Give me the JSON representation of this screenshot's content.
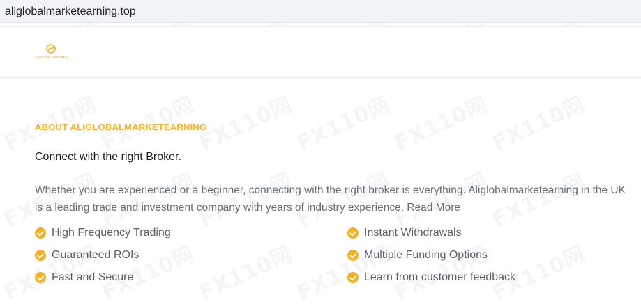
{
  "browser": {
    "url": "aliglobalmarketearning.top"
  },
  "header": {
    "logo_icon": "brand-logo-icon",
    "accent": "#f5b121"
  },
  "watermark": {
    "text": "FX110网"
  },
  "about": {
    "eyebrow": "ABOUT ALIGLOBALMARKETEARNING",
    "lead": "Connect with the right Broker.",
    "paragraph": "Whether you are experienced or a beginner, connecting with the right broker is everything. Aliglobalmarketearning in the UK is a leading trade and investment company with years of industry experience. Read More"
  },
  "features": [
    {
      "label": "High Frequency Trading",
      "icon": "check-circle-icon"
    },
    {
      "label": "Instant Withdrawals",
      "icon": "check-circle-icon"
    },
    {
      "label": "Guaranteed ROIs",
      "icon": "check-circle-icon"
    },
    {
      "label": "Multiple Funding Options",
      "icon": "check-circle-icon"
    },
    {
      "label": "Fast and Secure",
      "icon": "check-circle-icon"
    },
    {
      "label": "Learn from customer feedback",
      "icon": "check-circle-icon"
    }
  ]
}
